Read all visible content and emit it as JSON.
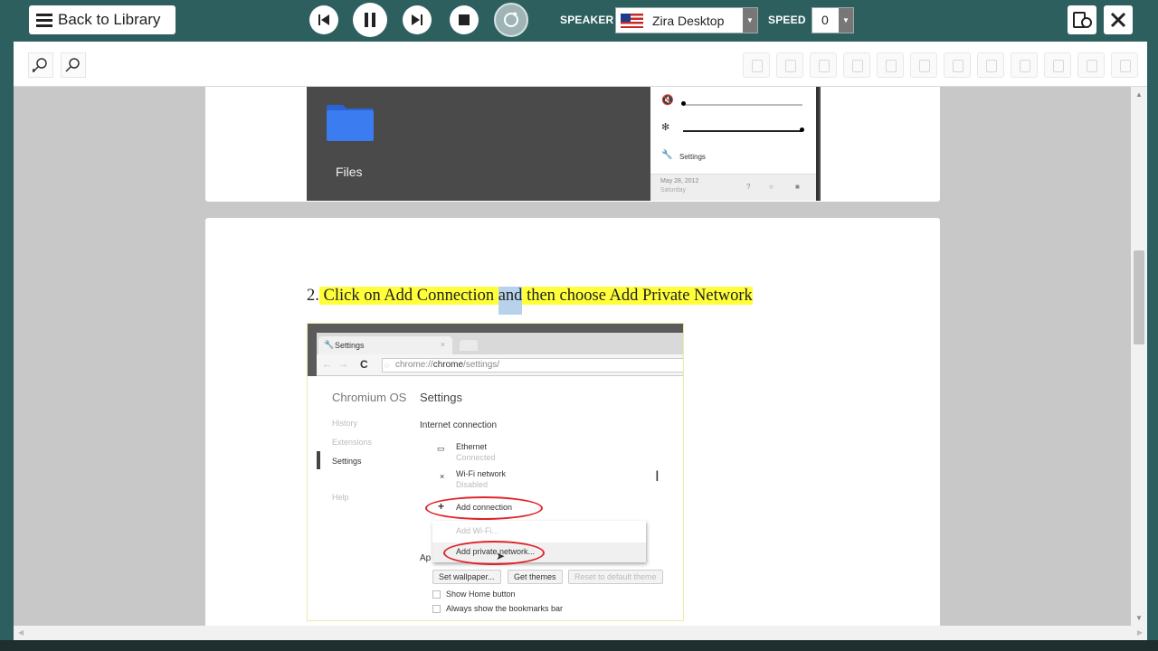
{
  "toolbar": {
    "back_label": "Back to Library",
    "speaker_label": "SPEAKER",
    "speaker_value": "Zira Desktop",
    "speed_label": "SPEED",
    "speed_value": "0"
  },
  "page1": {
    "folder_label": "Files",
    "tray_settings": "Settings",
    "tray_date": "May 28, 2012",
    "tray_day": "Saturday"
  },
  "page2": {
    "step_number": "2.",
    "step_part1": "Click on Add Connection",
    "step_selected": "and",
    "step_part2": "then choose Add Private Network"
  },
  "screenshot": {
    "tab_title": "Settings",
    "url_prefix": "chrome://",
    "url_bold": "chrome",
    "url_suffix": "/settings/",
    "brand": "Chromium OS",
    "page_heading": "Settings",
    "nav": [
      "History",
      "Extensions",
      "Settings",
      "Help"
    ],
    "section_title": "Internet connection",
    "ethernet": "Ethernet",
    "ethernet_status": "Connected",
    "wifi": "Wi-Fi network",
    "wifi_status": "Disabled",
    "add_connection": "Add connection",
    "add_wifi": "Add Wi-Fi...",
    "add_private": "Add private network...",
    "appearance_partial": "Ap",
    "btn_wallpaper": "Set wallpaper...",
    "btn_themes": "Get themes",
    "btn_reset": "Reset to default theme",
    "chk_home": "Show Home button",
    "chk_bookmarks": "Always show the bookmarks bar"
  },
  "colors": {
    "toolbar_bg": "#2e5f5f",
    "highlight": "#ffff3a",
    "selection": "#b7d3ec",
    "annotation_red": "#e0242a"
  }
}
